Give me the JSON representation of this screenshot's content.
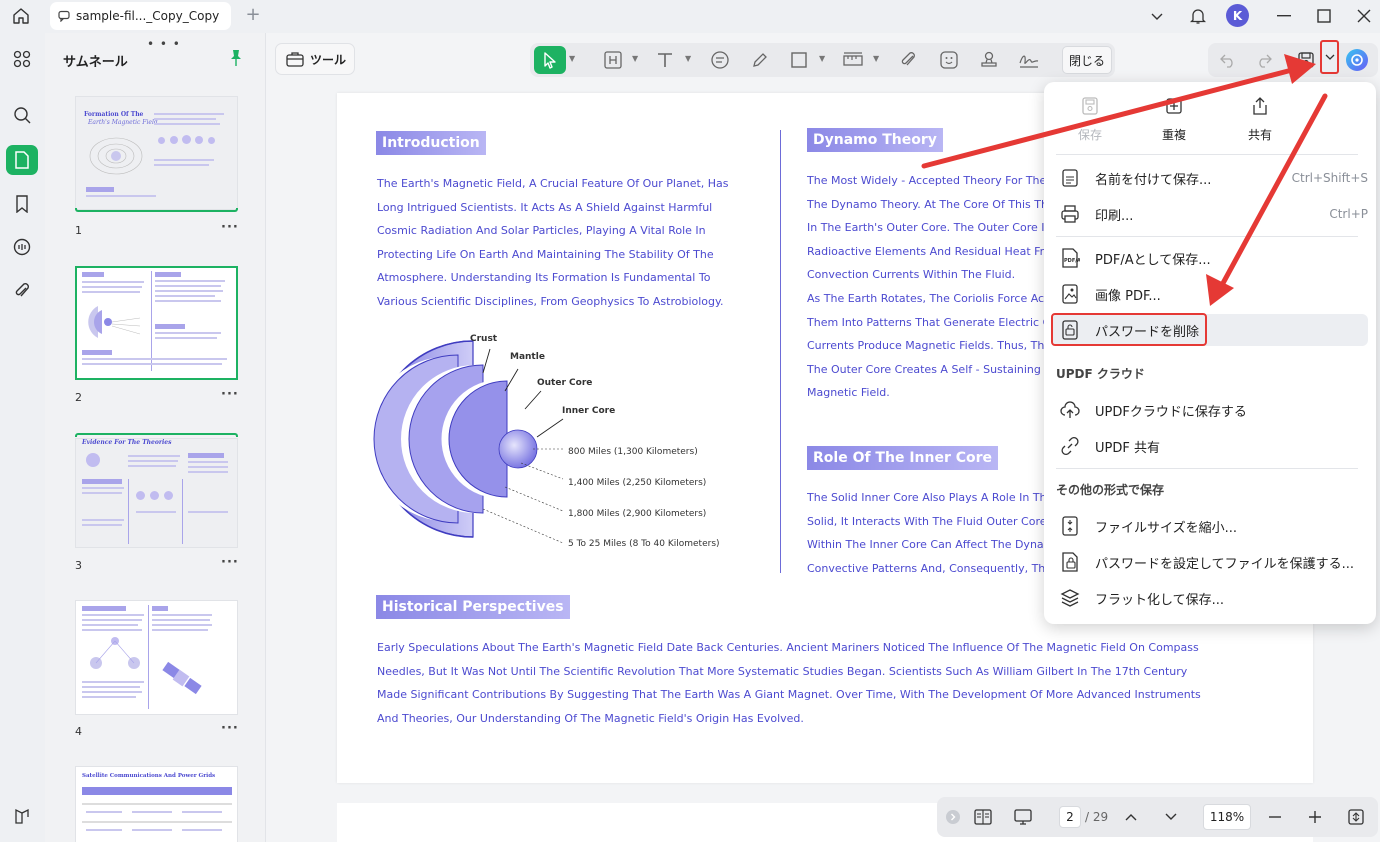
{
  "tab": {
    "title": "sample-fil..._Copy_Copy"
  },
  "user": {
    "initial": "K"
  },
  "thumbnails": {
    "title": "サムネール",
    "pages": [
      {
        "num": "1",
        "heading": "Formation Of The",
        "subheading": "Earth's Magnetic Field"
      },
      {
        "num": "2"
      },
      {
        "num": "3",
        "heading": "Evidence For The Theories"
      },
      {
        "num": "4"
      },
      {
        "num": "",
        "heading": "Satellite Communications And Power Grids"
      }
    ]
  },
  "toolbar": {
    "tools_label": "ツール",
    "close_label": "閉じる"
  },
  "document": {
    "intro_heading": "Introduction",
    "intro_text": "The Earth's Magnetic Field, A Crucial Feature Of Our Planet, Has Long Intrigued Scientists. It Acts As A Shield Against Harmful Cosmic Radiation And Solar Particles, Playing A Vital Role In Protecting Life On Earth And Maintaining The Stability Of The Atmosphere. Understanding Its Formation Is Fundamental To Various Scientific Disciplines, From Geophysics To Astrobiology.",
    "dynamo_heading": "Dynamo Theory",
    "dynamo_lines": [
      "The Most Widely - Accepted Theory For The For",
      "The Dynamo Theory. At The Core Of This Theor",
      "In The Earth's Outer Core. The Outer Core Is A I",
      "Radioactive Elements And Residual Heat From T",
      "Convection Currents Within The Fluid.",
      "As The Earth Rotates, The Coriolis Force Acts C",
      "Them Into Patterns That Generate Electric Curre",
      "Currents Produce Magnetic Fields. Thus, The Co",
      "The Outer Core Creates A Self - Sustaining Dyna",
      "Magnetic Field."
    ],
    "inner_core_heading": "Role Of The Inner Core",
    "inner_core_lines": [
      "The Solid Inner Core Also Plays A Role In The M",
      "Solid, It Interacts With The Fluid Outer Core. The",
      "Within The Inner Core Can Affect The Dynamics",
      "Convective Patterns And, Consequently, The Ma"
    ],
    "diagram": {
      "crust": "Crust",
      "mantle": "Mantle",
      "outer_core": "Outer Core",
      "inner_core": "Inner Core",
      "d1": "800 Miles (1,300 Kilometers)",
      "d2": "1,400 Miles (2,250 Kilometers)",
      "d3": "1,800 Miles (2,900 Kilometers)",
      "d4": "5 To 25 Miles (8 To 40 Kilometers)"
    },
    "history_heading": "Historical Perspectives",
    "history_text": "Early Speculations About The Earth's Magnetic Field Date Back Centuries. Ancient Mariners Noticed The Influence Of The Magnetic Field On Compass Needles, But It Was Not Until The Scientific Revolution That More Systematic Studies Began. Scientists Such As William Gilbert In The 17th Century Made Significant Contributions By Suggesting That The Earth Was A Giant Magnet. Over Time, With The Development Of More Advanced Instruments And Theories, Our Understanding Of The Magnetic Field's Origin Has Evolved."
  },
  "pager": {
    "current": "2",
    "total": "/ 29",
    "zoom": "118%"
  },
  "menu": {
    "top": [
      {
        "label": "保存",
        "disabled": true
      },
      {
        "label": "重複"
      },
      {
        "label": "共有"
      }
    ],
    "save_as": "名前を付けて保存...",
    "save_as_shortcut": "Ctrl+Shift+S",
    "print": "印刷...",
    "print_shortcut": "Ctrl+P",
    "pdfa": "PDF/Aとして保存...",
    "image_pdf": "画像 PDF...",
    "remove_password": "パスワードを削除",
    "cloud_heading": "UPDF クラウド",
    "save_cloud": "UPDFクラウドに保存する",
    "updf_share": "UPDF 共有",
    "other_heading": "その他の形式で保存",
    "reduce_size": "ファイルサイズを縮小...",
    "protect_password": "パスワードを設定してファイルを保護する...",
    "flatten": "フラット化して保存..."
  },
  "colors": {
    "accent": "#1db262",
    "doc_text": "#4c4ad0",
    "annotation": "#e53935"
  }
}
